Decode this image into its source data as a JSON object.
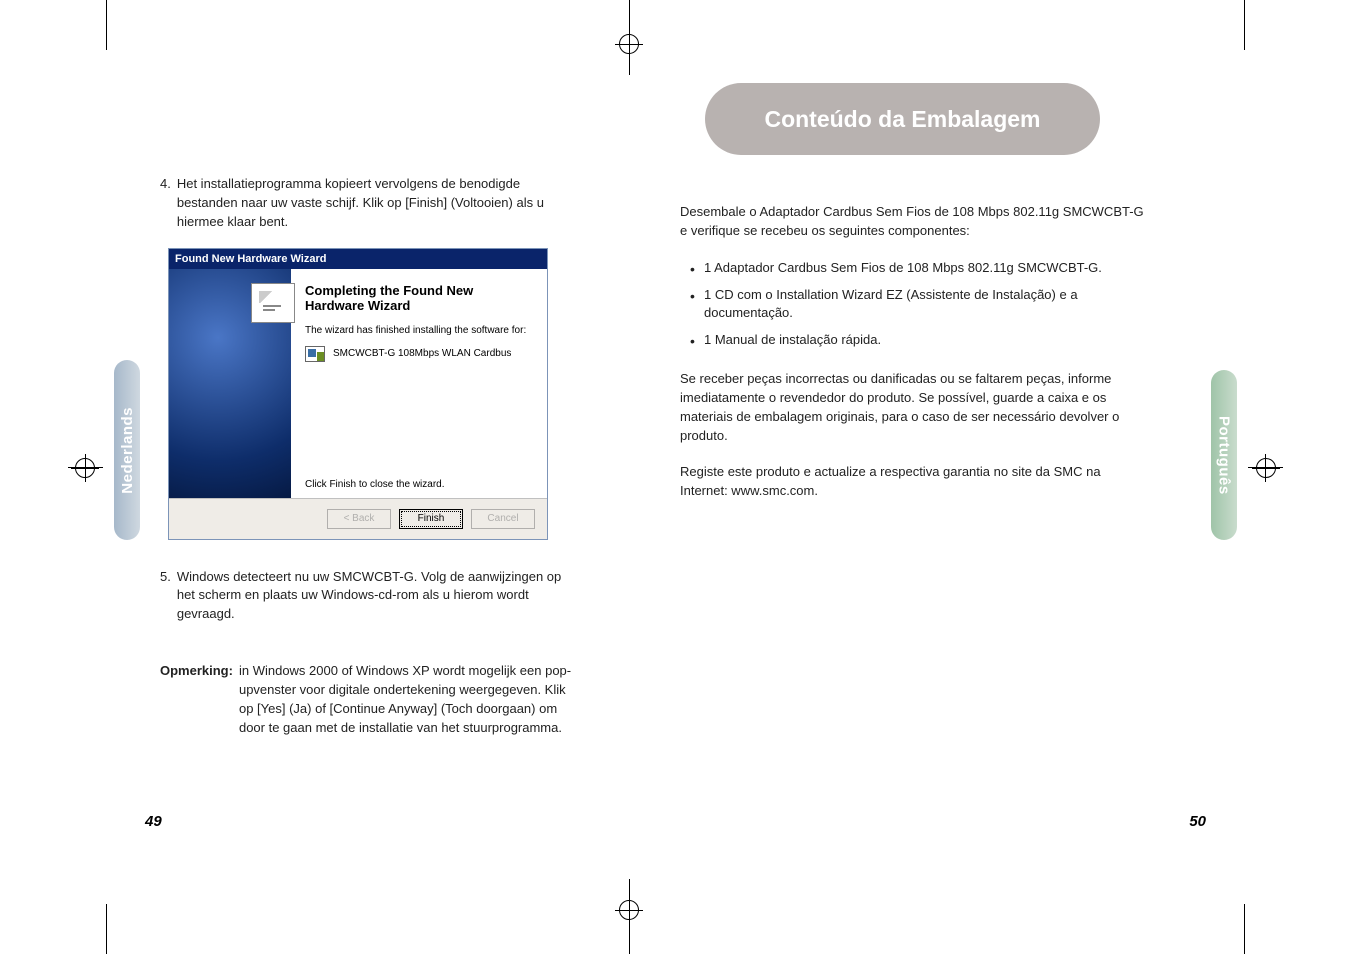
{
  "left_tab": "Nederlands",
  "right_tab": "Português",
  "page_left_num": "49",
  "page_right_num": "50",
  "left": {
    "step4_num": "4.",
    "step4_text": "Het installatieprogramma kopieert vervolgens de benodigde bestanden naar uw vaste schijf. Klik op [Finish] (Voltooien) als u hiermee klaar bent.",
    "step5_num": "5.",
    "step5_text": "Windows detecteert nu uw SMCWCBT-G. Volg de aanwijzingen op het scherm en plaats uw Windows-cd-rom als u hierom wordt gevraagd.",
    "note_label": "Opmerking:",
    "note_text": "in Windows 2000 of Windows XP wordt mogelijk een pop-upvenster voor digitale ondertekening weergegeven. Klik op [Yes] (Ja) of [Continue Anyway] (Toch doorgaan) om door te gaan met de installatie van het stuurprogramma."
  },
  "wizard": {
    "title": "Found New Hardware Wizard",
    "heading": "Completing the Found New Hardware Wizard",
    "subtext": "The wizard has finished installing the software for:",
    "device": "SMCWCBT-G 108Mbps WLAN Cardbus",
    "close_text": "Click Finish to close the wizard.",
    "btn_back": "< Back",
    "btn_finish": "Finish",
    "btn_cancel": "Cancel"
  },
  "right": {
    "heading": "Conteúdo da Embalagem",
    "intro": "Desembale o Adaptador Cardbus Sem Fios de 108 Mbps 802.11g SMCWCBT-G e verifique se recebeu os seguintes componentes:",
    "items": {
      "0": "1 Adaptador Cardbus Sem Fios de 108 Mbps 802.11g SMCWCBT-G.",
      "1": "1 CD com o Installation Wizard EZ (Assistente de Instalação) e a documentação.",
      "2": "1 Manual de instalação rápida."
    },
    "para2": "Se receber peças incorrectas ou danificadas ou se faltarem peças, informe imediatamente o revendedor do produto. Se possível, guarde a caixa e os materiais de embalagem originais, para o caso de ser necessário devolver o produto.",
    "para3": "Registe este produto e actualize a respectiva garantia no site da SMC na Internet: www.smc.com."
  }
}
